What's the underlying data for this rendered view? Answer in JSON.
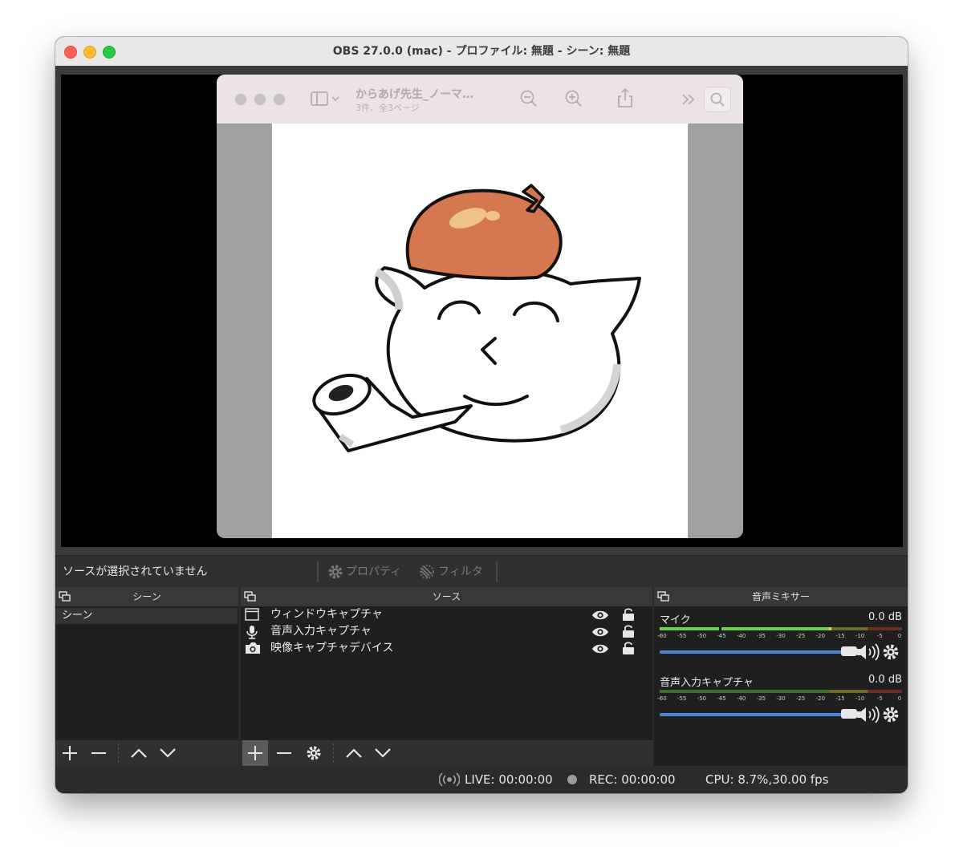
{
  "window": {
    "title": "OBS 27.0.0 (mac) - プロファイル: 無題 - シーン: 無題"
  },
  "captured_window": {
    "title": "からあげ先生_ノーマ…",
    "subtitle": "3件、全3ページ"
  },
  "controls": {
    "no_source_label": "ソースが選択されていません",
    "properties_label": "プロパティ",
    "filters_label": "フィルタ"
  },
  "scenes": {
    "header": "シーン",
    "items": [
      "シーン"
    ]
  },
  "sources": {
    "header": "ソース",
    "items": [
      {
        "label": "ウィンドウキャプチャ",
        "icon": "window-capture-icon"
      },
      {
        "label": "音声入力キャプチャ",
        "icon": "microphone-icon"
      },
      {
        "label": "映像キャプチャデバイス",
        "icon": "camera-icon"
      }
    ]
  },
  "mixer": {
    "header": "音声ミキサー",
    "tick_labels": [
      "-60",
      "-55",
      "-50",
      "-45",
      "-40",
      "-35",
      "-30",
      "-25",
      "-20",
      "-15",
      "-10",
      "-5",
      "0"
    ],
    "channels": [
      {
        "name": "マイク",
        "db": "0.0 dB",
        "level": 0.71
      },
      {
        "name": "音声入力キャプチャ",
        "db": "0.0 dB",
        "level": 0.0
      }
    ]
  },
  "status": {
    "live": "LIVE: 00:00:00",
    "rec": "REC: 00:00:00",
    "cpu": "CPU: 8.7%,30.00 fps"
  },
  "colors": {
    "meter_green": "#6fcf4a",
    "meter_yellow": "#e8d44a",
    "meter_red": "#d04a3a",
    "slider_blue": "#4c84d6"
  }
}
